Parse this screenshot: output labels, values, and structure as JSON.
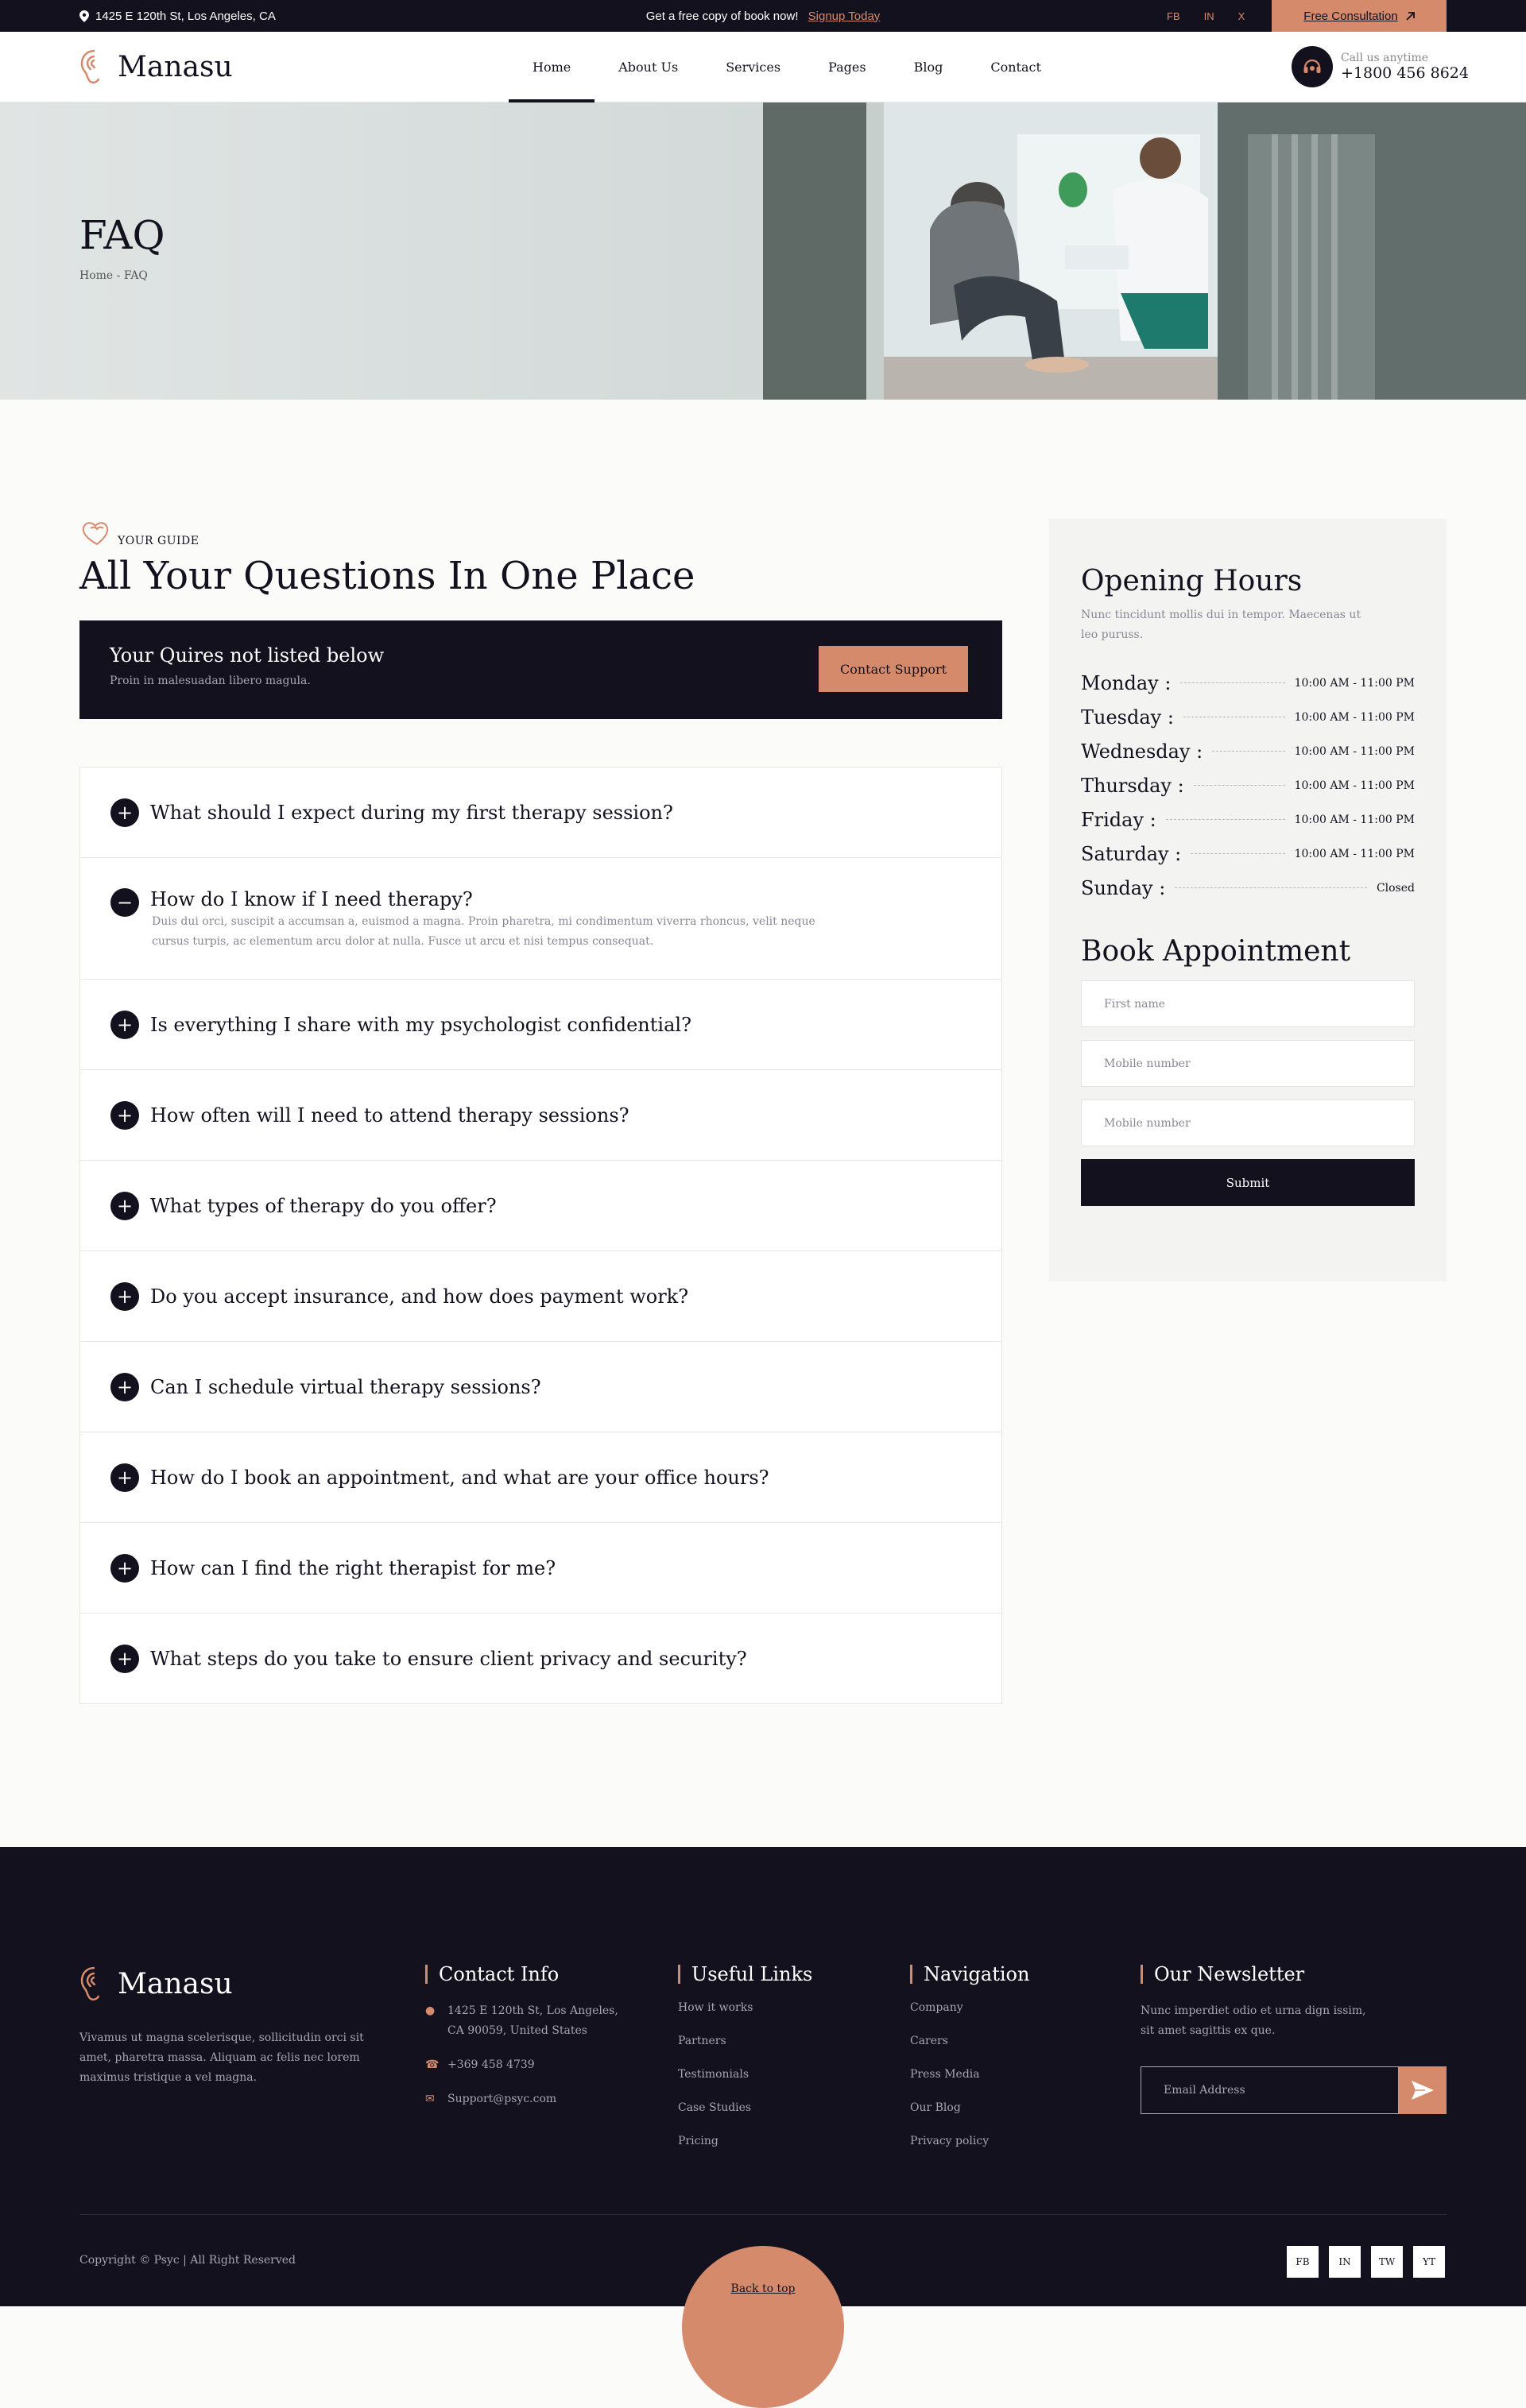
{
  "topbar": {
    "address": "1425 E 120th St, Los Angeles, CA",
    "promo_text": "Get a free copy of book now!",
    "promo_link": "Signup Today",
    "socials": [
      "FB",
      "IN",
      "X"
    ],
    "consult_label": "Free Consultation"
  },
  "header": {
    "brand": "Manasu",
    "nav": [
      "Home",
      "About Us",
      "Services",
      "Pages",
      "Blog",
      "Contact"
    ],
    "active_nav": "Home",
    "call_label": "Call us anytime",
    "call_number": "+1800 456 8624"
  },
  "hero": {
    "title": "FAQ",
    "breadcrumb": "Home - FAQ"
  },
  "faq_section": {
    "eyebrow": "YOUR GUIDE",
    "title": "All Your Questions In One Place",
    "quires_title": "Your Quires not listed below",
    "quires_sub": "Proin in malesuadan libero magula.",
    "contact_button": "Contact Support",
    "items": [
      {
        "q": "What should I expect during my first therapy session?",
        "open": false
      },
      {
        "q": "How do I know if I need therapy?",
        "open": true,
        "a": "Duis dui orci, suscipit a accumsan a, euismod a magna. Proin pharetra, mi condimentum viverra rhoncus, velit neque cursus turpis, ac elementum arcu dolor at nulla. Fusce ut arcu et nisi tempus consequat."
      },
      {
        "q": "Is everything I share with my psychologist confidential?",
        "open": false
      },
      {
        "q": "How often will I need to attend therapy sessions?",
        "open": false
      },
      {
        "q": "What types of therapy do you offer?",
        "open": false
      },
      {
        "q": "Do you accept insurance, and how does payment work?",
        "open": false
      },
      {
        "q": "Can I schedule virtual therapy sessions?",
        "open": false
      },
      {
        "q": "How do I book an appointment, and what are your office hours?",
        "open": false
      },
      {
        "q": "How can I find the right therapist for me?",
        "open": false
      },
      {
        "q": "What steps do you take to ensure client privacy and security?",
        "open": false
      }
    ]
  },
  "sidebar": {
    "hours_title": "Opening Hours",
    "hours_desc": "Nunc tincidunt mollis dui in tempor. Maecenas ut leo puruss.",
    "hours": [
      {
        "day": "Monday :",
        "time": "10:00 AM - 11:00 PM"
      },
      {
        "day": "Tuesday :",
        "time": "10:00 AM - 11:00 PM"
      },
      {
        "day": "Wednesday :",
        "time": "10:00 AM - 11:00 PM"
      },
      {
        "day": "Thursday :",
        "time": "10:00 AM - 11:00 PM"
      },
      {
        "day": "Friday :",
        "time": "10:00 AM - 11:00 PM"
      },
      {
        "day": "Saturday :",
        "time": "10:00 AM - 11:00 PM"
      },
      {
        "day": "Sunday :",
        "time": "Closed"
      }
    ],
    "book_title": "Book Appointment",
    "fields": [
      "First name",
      "Mobile number",
      "Mobile number"
    ],
    "submit_label": "Submit"
  },
  "footer": {
    "brand": "Manasu",
    "about": "Vivamus ut magna scelerisque, sollicitudin orci sit amet, pharetra massa. Aliquam ac felis nec lorem maximus tristique a vel magna.",
    "contact_title": "Contact Info",
    "contact_address": "1425 E 120th St, Los Angeles, CA 90059, United States",
    "contact_phone": "+369 458 4739",
    "contact_email": "Support@psyc.com",
    "useful_title": "Useful Links",
    "useful_links": [
      "How it works",
      "Partners",
      "Testimonials",
      "Case Studies",
      "Pricing"
    ],
    "nav_title": "Navigation",
    "nav_links": [
      "Company",
      "Carers",
      "Press Media",
      "Our Blog",
      "Privacy policy"
    ],
    "news_title": "Our Newsletter",
    "news_desc": "Nunc imperdiet odio et urna dign issim, sit amet sagittis ex que.",
    "news_placeholder": "Email Address",
    "copyright": "Copyright © Psyc | All Right Reserved",
    "back_to_top": "Back to top",
    "socials": [
      "FB",
      "IN",
      "TW",
      "YT"
    ]
  },
  "colors": {
    "dark": "#14111f",
    "accent": "#d58a6b",
    "muted": "#8a8794",
    "panel": "#f3f3f2"
  }
}
